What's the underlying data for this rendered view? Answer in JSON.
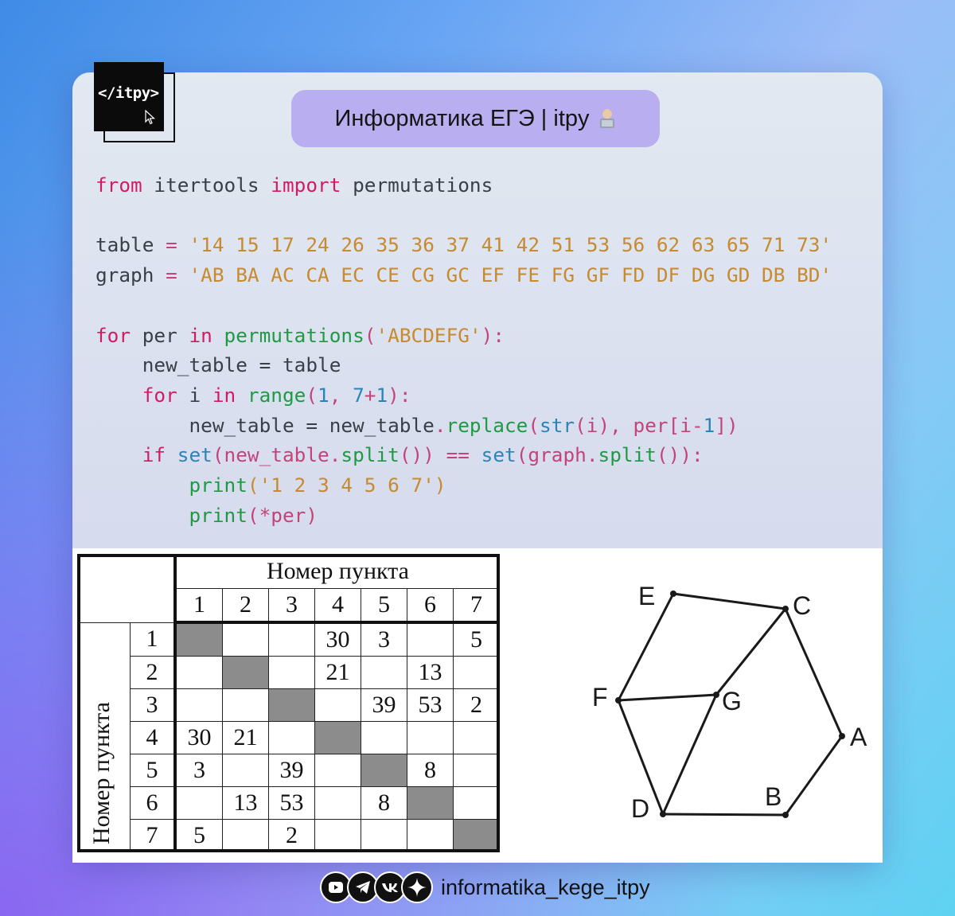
{
  "logo": {
    "text": "</itpy>",
    "icon": "cursor-arrow-icon"
  },
  "header": {
    "title": "Информатика ЕГЭ | itpy",
    "icon": "person-with-laptop-icon"
  },
  "code": {
    "kw_from": "from",
    "mod": " itertools ",
    "kw_import": "import",
    "imp_name": " permutations",
    "table_name": "table",
    "table_eq": " = ",
    "table_str": "'14 15 17 24 26 35 36 37 41 42 51 53 56 62 63 65 71 73'",
    "graph_name": "graph",
    "graph_eq": " = ",
    "graph_str": "'AB BA AC CA EC CE CG GC EF FE FG GF FD DF DG GD DB BD'",
    "l5_for": "for",
    "l5_per": " per ",
    "l5_in": "in",
    "l5_fn": " permutations",
    "l5_open": "(",
    "l5_str": "'ABCDEFG'",
    "l5_close": "):",
    "l6": "    new_table = table",
    "l7_ind": "    ",
    "l7_for": "for",
    "l7_i": " i ",
    "l7_in": "in",
    "l7_range": " range",
    "l7_open": "(",
    "l7_1": "1",
    "l7_comma": ", ",
    "l7_7": "7",
    "l7_plus": "+",
    "l7_1b": "1",
    "l7_close": "):",
    "l8_pre": "        new_table = new_table",
    "l8_dot": ".",
    "l8_fn": "replace",
    "l8_open": "(",
    "l8_str": "str",
    "l8_args": "(i), ",
    "l8_per": "per[i-",
    "l8_one": "1",
    "l8_end": "])",
    "l9_ind": "    ",
    "l9_if": "if",
    "l9_set": " set",
    "l9_a": "(new_table.",
    "l9_split": "split",
    "l9_b": "()) ",
    "l9_eq": "==",
    "l9_set2": " set",
    "l9_c": "(graph.",
    "l9_split2": "split",
    "l9_d": "()):",
    "l10_ind": "        ",
    "l10_fn": "print",
    "l10_str": "('1 2 3 4 5 6 7')",
    "l11_ind": "        ",
    "l11_fn": "print",
    "l11_args": "(*per)"
  },
  "table": {
    "col_title": "Номер пункта",
    "row_title": "Номер пункта",
    "cols": [
      "1",
      "2",
      "3",
      "4",
      "5",
      "6",
      "7"
    ],
    "rows": [
      {
        "n": "1",
        "c": [
          "",
          "",
          "",
          "30",
          "3",
          "",
          "5"
        ]
      },
      {
        "n": "2",
        "c": [
          "",
          "",
          "",
          "21",
          "",
          "13",
          ""
        ]
      },
      {
        "n": "3",
        "c": [
          "",
          "",
          "",
          "",
          "39",
          "53",
          "2"
        ]
      },
      {
        "n": "4",
        "c": [
          "30",
          "21",
          "",
          "",
          "",
          "",
          ""
        ]
      },
      {
        "n": "5",
        "c": [
          "3",
          "",
          "39",
          "",
          "",
          "8",
          ""
        ]
      },
      {
        "n": "6",
        "c": [
          "",
          "13",
          "53",
          "",
          "8",
          "",
          ""
        ]
      },
      {
        "n": "7",
        "c": [
          "5",
          "",
          "2",
          "",
          "",
          "",
          ""
        ]
      }
    ]
  },
  "graph": {
    "nodes": [
      {
        "id": "E",
        "label": "E"
      },
      {
        "id": "C",
        "label": "C"
      },
      {
        "id": "F",
        "label": "F"
      },
      {
        "id": "G",
        "label": "G"
      },
      {
        "id": "A",
        "label": "A"
      },
      {
        "id": "B",
        "label": "B"
      },
      {
        "id": "D",
        "label": "D"
      }
    ],
    "edges": [
      [
        "E",
        "C"
      ],
      [
        "E",
        "F"
      ],
      [
        "C",
        "G"
      ],
      [
        "C",
        "A"
      ],
      [
        "F",
        "G"
      ],
      [
        "F",
        "D"
      ],
      [
        "G",
        "D"
      ],
      [
        "D",
        "B"
      ],
      [
        "B",
        "A"
      ]
    ]
  },
  "footer": {
    "icons": [
      "youtube-icon",
      "telegram-icon",
      "vk-icon",
      "sparkle-icon"
    ],
    "handle": "informatika_kege_itpy"
  }
}
